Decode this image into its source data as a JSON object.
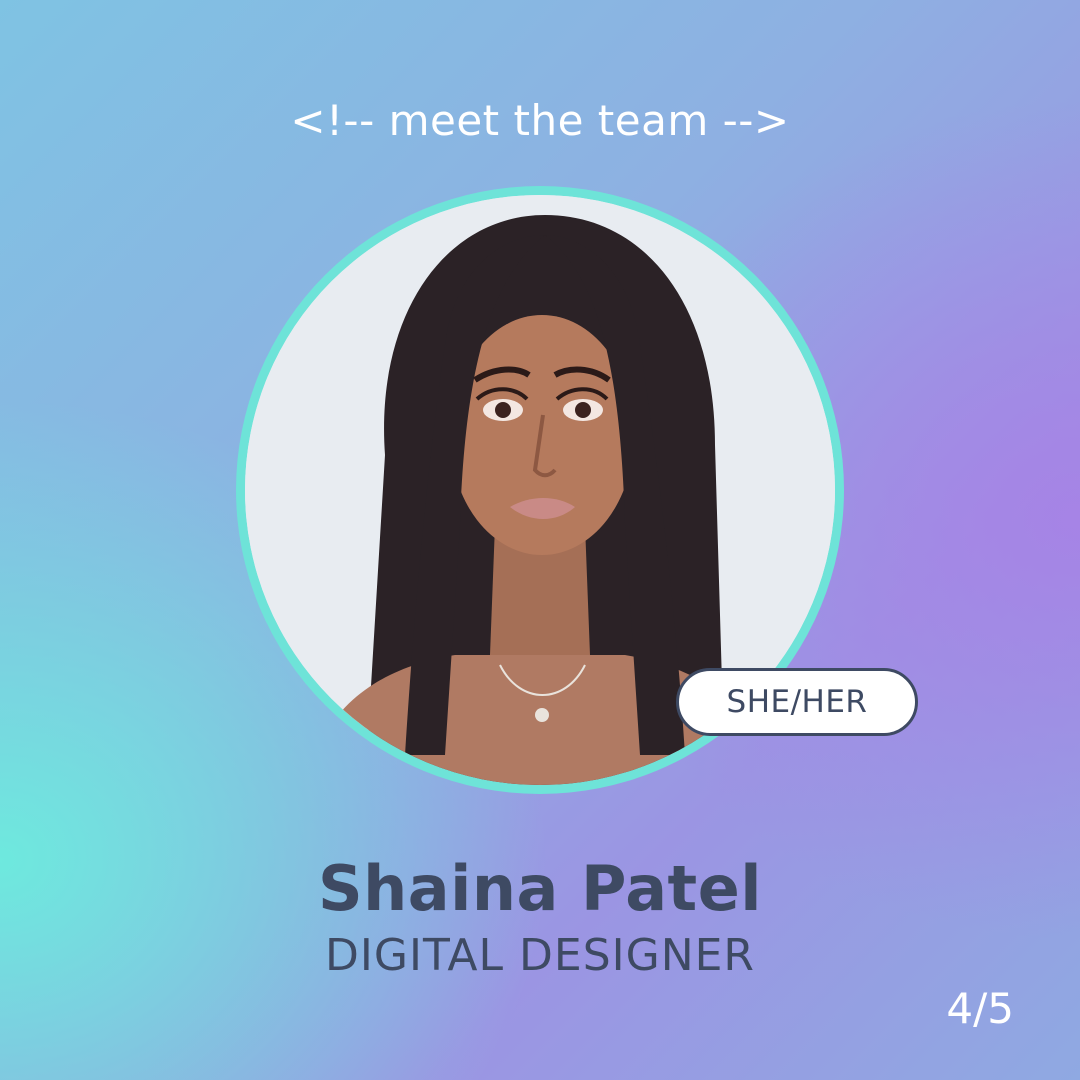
{
  "header": {
    "eyebrow": "<!-- meet the team -->"
  },
  "profile": {
    "name": "Shaina Patel",
    "role": "DIGITAL DESIGNER",
    "pronouns": "SHE/HER"
  },
  "pagination": {
    "label": "4/5"
  },
  "colors": {
    "ring": "#6ee3d8",
    "text_dark": "#3e4a63",
    "text_light": "#ffffff",
    "gradient_teal": "#6cecde",
    "gradient_purple": "#a880e6"
  }
}
